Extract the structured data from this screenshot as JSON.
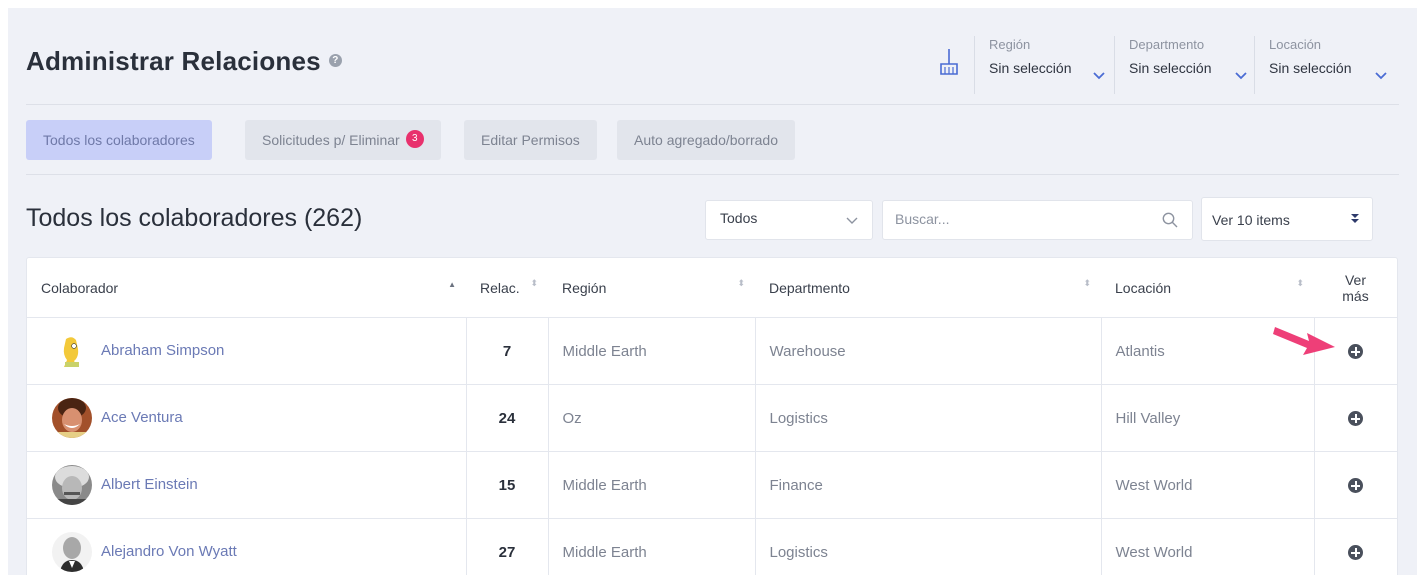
{
  "header": {
    "title": "Administrar Relaciones",
    "help_icon": "?",
    "filters": [
      {
        "label": "Región",
        "value": "Sin selección"
      },
      {
        "label": "Departmento",
        "value": "Sin selección"
      },
      {
        "label": "Locación",
        "value": "Sin selección"
      }
    ]
  },
  "tabs": [
    {
      "label": "Todos los colaboradores",
      "active": true
    },
    {
      "label": "Solicitudes p/ Eliminar",
      "badge": "3"
    },
    {
      "label": "Editar Permisos"
    },
    {
      "label": "Auto agregado/borrado"
    }
  ],
  "section": {
    "title": "Todos los colaboradores (262)",
    "filter_value": "Todos",
    "search_placeholder": "Buscar...",
    "per_page": "Ver 10 items"
  },
  "table": {
    "columns": [
      "Colaborador",
      "Relac.",
      "Región",
      "Departmento",
      "Locación",
      "Ver más"
    ],
    "rows": [
      {
        "name": "Abraham Simpson",
        "relac": "7",
        "region": "Middle Earth",
        "department": "Warehouse",
        "location": "Atlantis"
      },
      {
        "name": "Ace Ventura",
        "relac": "24",
        "region": "Oz",
        "department": "Logistics",
        "location": "Hill Valley"
      },
      {
        "name": "Albert Einstein",
        "relac": "15",
        "region": "Middle Earth",
        "department": "Finance",
        "location": "West World"
      },
      {
        "name": "Alejandro Von Wyatt",
        "relac": "27",
        "region": "Middle Earth",
        "department": "Logistics",
        "location": "West World"
      }
    ]
  },
  "colors": {
    "accent": "#c8cff8",
    "link": "#6b7ab5",
    "badge": "#e8316d",
    "annotation_arrow": "#ee3f78"
  },
  "icons": [
    "help-icon",
    "broom-icon",
    "chevron-down-icon",
    "search-icon",
    "double-chevron-icon",
    "plus-circle-icon",
    "annotation-arrow-icon"
  ]
}
